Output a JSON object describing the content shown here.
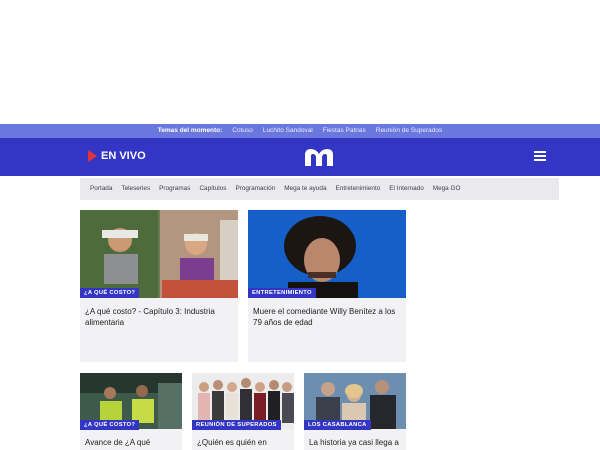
{
  "trending": {
    "label": "Temas del momento:",
    "items": [
      "Cotuso",
      "Luchito Sandoval",
      "Fiestas Patrias",
      "Reunión de Superados"
    ]
  },
  "header": {
    "live_label": "EN VIVO",
    "logo_icon": "mega-logo-icon",
    "menu_icon": "hamburger-menu-icon"
  },
  "nav": {
    "items": [
      "Portada",
      "Teleseries",
      "Programas",
      "Capítulos",
      "Programación",
      "Mega te ayuda",
      "Entretenimiento",
      "El Internado",
      "Mega GO"
    ],
    "search_icon": "search-icon"
  },
  "articles": [
    {
      "tag": "¿A QUÉ COSTO?",
      "title": "¿A qué costo? - Capítulo 3: Industria alimentaria"
    },
    {
      "tag": "ENTRETENIMIENTO",
      "title": "Muere el comediante Willy Benítez a los 79 años de edad"
    },
    {
      "tag": "¿A QUÉ COSTO?",
      "title": "Avance de ¿A qué"
    },
    {
      "tag": "REUNIÓN DE SUPERADOS",
      "title": "¿Quién es quién en"
    },
    {
      "tag": "LOS CASABLANCA",
      "title": "La historia ya casi llega a"
    }
  ],
  "colors": {
    "brand": "#3335c5",
    "trending_bar": "#6a78de",
    "live_red": "#e53238"
  }
}
